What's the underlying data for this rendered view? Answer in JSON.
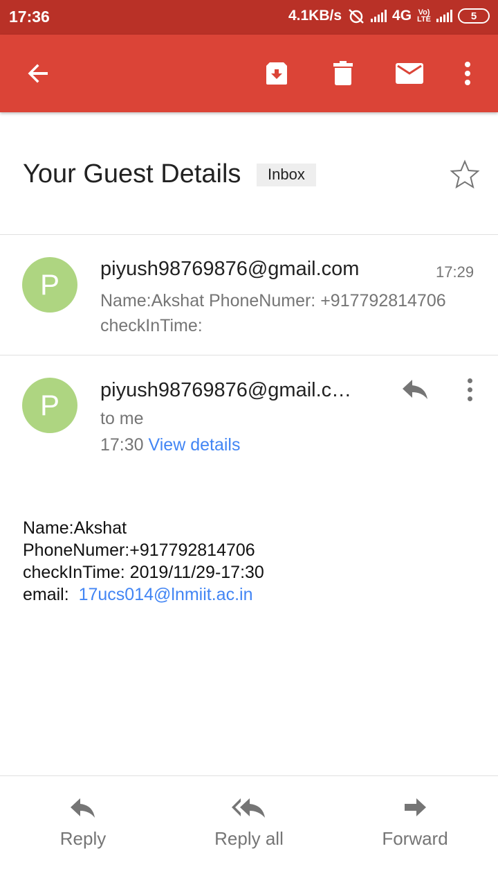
{
  "status_bar": {
    "time": "17:36",
    "network_speed": "4.1KB/s",
    "network_type": "4G",
    "volte_top": "Vo)",
    "volte_bottom": "LTE",
    "battery": "5"
  },
  "toolbar": {
    "icons": [
      "back-arrow-icon",
      "archive-icon",
      "delete-icon",
      "mark-unread-icon",
      "more-vert-icon"
    ]
  },
  "subject": {
    "title": "Your Guest Details",
    "label": "Inbox"
  },
  "messages": [
    {
      "avatar_letter": "P",
      "sender": "piyush98769876@gmail.com",
      "time": "17:29",
      "snippet": "Name:Akshat PhoneNumer: +917792814706 checkInTime:"
    },
    {
      "avatar_letter": "P",
      "sender": "piyush98769876@gmail.c…",
      "to": "to me",
      "time": "17:30",
      "details_link": "View details"
    }
  ],
  "body": {
    "line1": "Name:Akshat",
    "line2": "PhoneNumer:+917792814706",
    "line3": "checkInTime: 2019/11/29-17:30",
    "email_label": "email:  ",
    "email_link": "17ucs014@lnmiit.ac.in"
  },
  "actions": {
    "reply": "Reply",
    "reply_all": "Reply all",
    "forward": "Forward"
  },
  "colors": {
    "status_bar": "#b93127",
    "toolbar": "#db4437",
    "avatar": "#aed581",
    "link": "#4285f4"
  }
}
